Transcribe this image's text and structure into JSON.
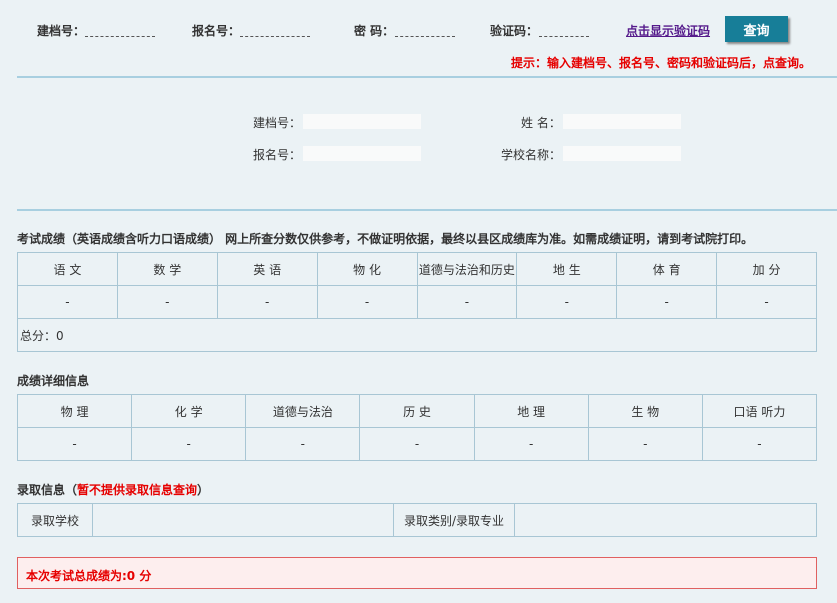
{
  "query_form": {
    "archive_no_label": "建档号：",
    "archive_no_value": "",
    "reg_no_label": "报名号：",
    "reg_no_value": "",
    "password_label": "密 码：",
    "password_value": "",
    "captcha_label": "验证码：",
    "captcha_value": "",
    "show_captcha_link": "点击显示验证码",
    "query_button": "查询",
    "hint": "提示：输入建档号、报名号、密码和验证码后，点查询。"
  },
  "info": {
    "archive_no_label": "建档号：",
    "archive_no_value": "",
    "name_label": "姓 名：",
    "name_value": "",
    "reg_no_label": "报名号：",
    "reg_no_value": "",
    "school_label": "学校名称：",
    "school_value": ""
  },
  "exam_scores": {
    "title": "考试成绩（英语成绩含听力口语成绩）  网上所查分数仅供参考，不做证明依据，最终以县区成绩库为准。如需成绩证明，请到考试院打印。",
    "headers": [
      "语 文",
      "数 学",
      "英 语",
      "物 化",
      "道德与法治和历史",
      "地 生",
      "体 育",
      "加 分"
    ],
    "values": [
      "-",
      "-",
      "-",
      "-",
      "-",
      "-",
      "-",
      "-"
    ],
    "total": "总分：0"
  },
  "detail_scores": {
    "title": "成绩详细信息",
    "headers": [
      "物 理",
      "化 学",
      "道德与法治",
      "历 史",
      "地 理",
      "生 物",
      "口语 听力"
    ],
    "values": [
      "-",
      "-",
      "-",
      "-",
      "-",
      "-",
      "-"
    ]
  },
  "admission": {
    "title_prefix": "录取信息（",
    "title_note": "暂不提供录取信息查询",
    "title_suffix": "）",
    "school_label": "录取学校",
    "school_value": "",
    "category_label": "录取类别/录取专业",
    "category_value": ""
  },
  "final_total": "本次考试总成绩为:0 分",
  "colors": {
    "background": "#ebf2f5",
    "accent_button": "#177e98",
    "warning_red": "#e60000",
    "divider": "#a8cfe0",
    "table_border": "#a8c6d4",
    "final_box_bg": "#fdeeee"
  }
}
